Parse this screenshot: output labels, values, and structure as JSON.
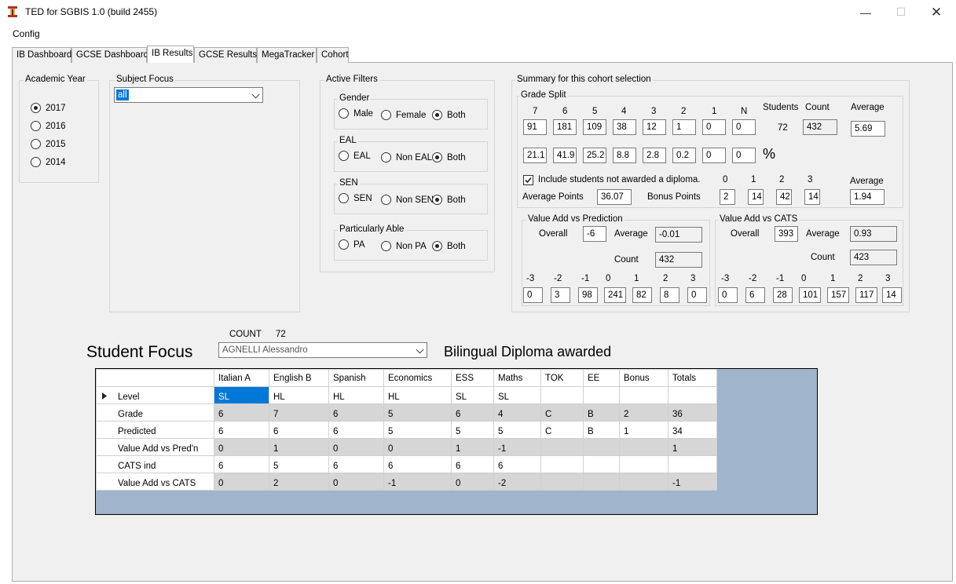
{
  "window": {
    "title": "TED for SGBIS 1.0 (build 2455)"
  },
  "menu": {
    "config": "Config"
  },
  "tabs": [
    {
      "label": "IB Dashboard"
    },
    {
      "label": "GCSE Dashboard"
    },
    {
      "label": "IB Results"
    },
    {
      "label": "GCSE Results"
    },
    {
      "label": "MegaTracker"
    },
    {
      "label": "Cohort"
    }
  ],
  "academic_year": {
    "label": "Academic Year",
    "options": [
      "2017",
      "2016",
      "2015",
      "2014"
    ],
    "selected": "2017"
  },
  "subject_focus": {
    "label": "Subject Focus",
    "value": "all"
  },
  "filters": {
    "label": "Active Filters",
    "gender": {
      "label": "Gender",
      "options": [
        "Male",
        "Female",
        "Both"
      ],
      "selected": "Both"
    },
    "eal": {
      "label": "EAL",
      "options": [
        "EAL",
        "Non EAL",
        "Both"
      ],
      "selected": "Both"
    },
    "sen": {
      "label": "SEN",
      "options": [
        "SEN",
        "Non SEN",
        "Both"
      ],
      "selected": "Both"
    },
    "pa": {
      "label": "Particularly Able",
      "options": [
        "PA",
        "Non PA",
        "Both"
      ],
      "selected": "Both"
    }
  },
  "summary": {
    "label": "Summary for this cohort selection",
    "grade_split": {
      "label": "Grade Split",
      "grades": [
        "7",
        "6",
        "5",
        "4",
        "3",
        "2",
        "1",
        "N"
      ],
      "counts": [
        "91",
        "181",
        "109",
        "38",
        "12",
        "1",
        "0",
        "0"
      ],
      "percents": [
        "21.1",
        "41.9",
        "25.2",
        "8.8",
        "2.8",
        "0.2",
        "0",
        "0"
      ],
      "percent_sign": "%",
      "students_label": "Students",
      "students": "72",
      "count_label": "Count",
      "count": "432",
      "average_label": "Average",
      "average": "5.69"
    },
    "diploma": {
      "include_label": "Include students not awarded a diploma.",
      "checked": true,
      "avg_points_label": "Average Points",
      "avg_points": "36.07",
      "bonus_label": "Bonus Points",
      "bonus_headers": [
        "0",
        "1",
        "2",
        "3"
      ],
      "bonus_counts": [
        "2",
        "14",
        "42",
        "14"
      ],
      "average_label": "Average",
      "average": "1.94"
    },
    "va_pred": {
      "label": "Value Add vs Prediction",
      "overall_label": "Overall",
      "overall": "-6",
      "average_label": "Average",
      "average": "-0.01",
      "count_label": "Count",
      "count": "432",
      "headers": [
        "-3",
        "-2",
        "-1",
        "0",
        "1",
        "2",
        "3"
      ],
      "counts": [
        "0",
        "3",
        "98",
        "241",
        "82",
        "8",
        "0"
      ]
    },
    "va_cats": {
      "label": "Value Add vs CATS",
      "overall_label": "Overall",
      "overall": "393",
      "average_label": "Average",
      "average": "0.93",
      "count_label": "Count",
      "count": "423",
      "headers": [
        "-3",
        "-2",
        "-1",
        "0",
        "1",
        "2",
        "3"
      ],
      "counts": [
        "0",
        "6",
        "28",
        "101",
        "157",
        "117",
        "14"
      ]
    }
  },
  "student_focus": {
    "count_label": "COUNT",
    "count": "72",
    "label": "Student Focus",
    "selected_student": "AGNELLI Alessandro",
    "status": "Bilingual Diploma awarded"
  },
  "grid": {
    "columns": [
      "Italian A",
      "English B",
      "Spanish",
      "Economics",
      "ESS",
      "Maths",
      "TOK",
      "EE",
      "Bonus",
      "Totals"
    ],
    "rows": [
      {
        "label": "Level",
        "cells": [
          "SL",
          "HL",
          "HL",
          "HL",
          "SL",
          "SL",
          "",
          "",
          "",
          ""
        ]
      },
      {
        "label": "Grade",
        "cells": [
          "6",
          "7",
          "6",
          "5",
          "6",
          "4",
          "C",
          "B",
          "2",
          "36"
        ]
      },
      {
        "label": "Predicted",
        "cells": [
          "6",
          "6",
          "6",
          "5",
          "5",
          "5",
          "C",
          "B",
          "1",
          "34"
        ]
      },
      {
        "label": "Value Add vs Pred'n",
        "cells": [
          "0",
          "1",
          "0",
          "0",
          "1",
          "-1",
          "",
          "",
          "",
          "1"
        ]
      },
      {
        "label": "CATS ind",
        "cells": [
          "6",
          "5",
          "6",
          "6",
          "6",
          "6",
          "",
          "",
          "",
          ""
        ]
      },
      {
        "label": "Value Add vs CATS",
        "cells": [
          "0",
          "2",
          "0",
          "-1",
          "0",
          "-2",
          "",
          "",
          "",
          "-1"
        ]
      }
    ]
  }
}
